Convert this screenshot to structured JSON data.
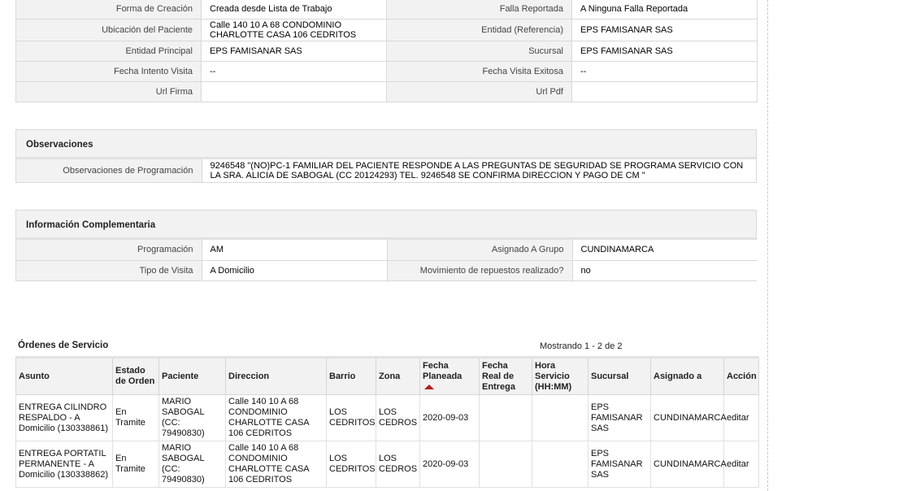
{
  "details": [
    {
      "label1": "Forma de Creación",
      "value1": "Creada desde Lista de Trabajo",
      "label2": "Falla Reportada",
      "value2": "A Ninguna Falla Reportada"
    },
    {
      "label1": "Ubicación del Paciente",
      "value1": "Calle 140 10 A 68 CONDOMINIO CHARLOTTE CASA 106 CEDRITOS",
      "label2": "Entidad (Referencia)",
      "value2": "EPS FAMISANAR SAS"
    },
    {
      "label1": "Entidad Principal",
      "value1": "EPS FAMISANAR SAS",
      "label2": "Sucursal",
      "value2": "EPS FAMISANAR SAS"
    },
    {
      "label1": "Fecha Intento Visita",
      "value1": "--",
      "label2": "Fecha Visita Exitosa",
      "value2": "--"
    },
    {
      "label1": "Url Firma",
      "value1": "",
      "label2": "Url Pdf",
      "value2": ""
    }
  ],
  "observaciones": {
    "title": "Observaciones",
    "label": "Observaciones de Programación",
    "value": "9246548 \"(NO)PC-1 FAMILIAR DEL PACIENTE RESPONDE A LAS PREGUNTAS DE SEGURIDAD SE PROGRAMA SERVICIO CON LA SRA. ALICIA DE SABOGAL (CC 20124293) TEL. 9246548 SE CONFIRMA DIRECCION Y PAGO DE CM \""
  },
  "info": {
    "title": "Información Complementaria",
    "rows": [
      {
        "label1": "Programación",
        "value1": "AM",
        "label2": "Asignado A Grupo",
        "value2": "CUNDINAMARCA"
      },
      {
        "label1": "Tipo de Visita",
        "value1": "A Domicilio",
        "label2": "Movimiento de repuestos realizado?",
        "value2": "no"
      }
    ]
  },
  "orders": {
    "title": "Órdenes de Servicio",
    "count": "Mostrando 1 - 2 de 2",
    "columns": [
      "Asunto",
      "Estado de Orden",
      "Paciente",
      "Direccion",
      "Barrio",
      "Zona",
      "Fecha Planeada",
      "Fecha Real de Entrega",
      "Hora Servicio (HH:MM)",
      "Sucursal",
      "Asignado a",
      "Acción"
    ],
    "rows": [
      {
        "asunto": "ENTREGA CILINDRO RESPALDO - A Domicilio (130338861)",
        "estado": "En Tramite",
        "paciente": "MARIO SABOGAL (CC: 79490830)",
        "direccion": "Calle 140 10 A 68 CONDOMINIO CHARLOTTE CASA 106 CEDRITOS",
        "barrio": "LOS CEDRITOS",
        "zona": "LOS CEDROS",
        "fecha_planeada": "2020-09-03",
        "fecha_real": "",
        "hora": "",
        "sucursal": "EPS FAMISANAR SAS",
        "asignado": "CUNDINAMARCA",
        "accion": "editar"
      },
      {
        "asunto": "ENTREGA PORTATIL PERMANENTE - A Domicilio (130338862)",
        "estado": "En Tramite",
        "paciente": "MARIO SABOGAL (CC: 79490830)",
        "direccion": "Calle 140 10 A 68 CONDOMINIO CHARLOTTE CASA 106 CEDRITOS",
        "barrio": "LOS CEDRITOS",
        "zona": "LOS CEDROS",
        "fecha_planeada": "2020-09-03",
        "fecha_real": "",
        "hora": "",
        "sucursal": "EPS FAMISANAR SAS",
        "asignado": "CUNDINAMARCA",
        "accion": "editar"
      }
    ]
  }
}
